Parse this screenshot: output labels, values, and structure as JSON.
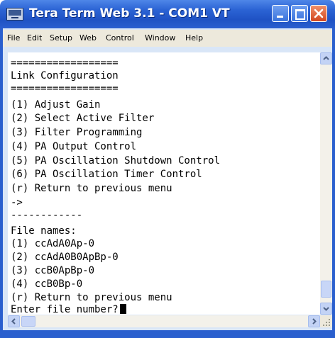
{
  "window": {
    "title": "Tera Term Web 3.1 - COM1 VT"
  },
  "menu": {
    "items": [
      "File",
      "Edit",
      "Setup",
      "Web",
      "Control",
      "Window",
      "Help"
    ]
  },
  "terminal": {
    "lines": [
      "==================",
      "Link Configuration",
      "==================",
      "(1) Adjust Gain",
      "(2) Select Active Filter",
      "(3) Filter Programming",
      "(4) PA Output Control",
      "(5) PA Oscillation Shutdown Control",
      "(6) PA Oscillation Timer Control",
      "(r) Return to previous menu",
      "->",
      "------------",
      "File names:",
      "(1) ccAdA0Ap-0",
      "(2) ccAdA0B0ApBp-0",
      "(3) ccB0ApBp-0",
      "(4) ccB0Bp-0",
      "(r) Return to previous menu",
      "Enter file number?"
    ]
  },
  "icons": {
    "app": "terminal-app-icon",
    "minimize": "minimize-icon",
    "maximize": "maximize-icon",
    "close": "close-icon",
    "scroll_up": "chevron-up-icon",
    "scroll_down": "chevron-down-icon",
    "scroll_left": "chevron-left-icon",
    "scroll_right": "chevron-right-icon"
  },
  "colors": {
    "titlebar": "#2b63d4",
    "close_button": "#d2461f",
    "terminal_bg": "#ffffff",
    "terminal_text": "#000000"
  }
}
